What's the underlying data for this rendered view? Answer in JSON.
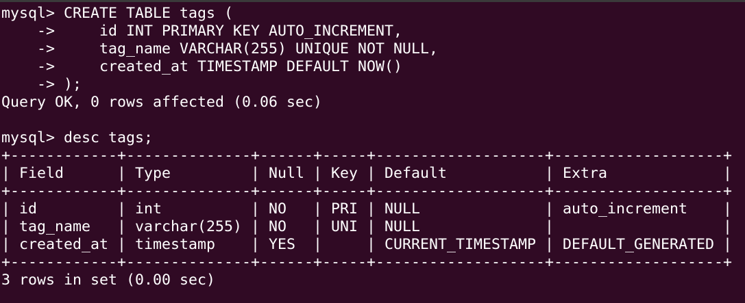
{
  "terminal": {
    "lines": [
      "mysql> CREATE TABLE tags (",
      "    ->     id INT PRIMARY KEY AUTO_INCREMENT,",
      "    ->     tag_name VARCHAR(255) UNIQUE NOT NULL,",
      "    ->     created_at TIMESTAMP DEFAULT NOW()",
      "    -> );",
      "Query OK, 0 rows affected (0.06 sec)",
      "",
      "mysql> desc tags;",
      "+------------+--------------+------+-----+-------------------+-------------------+",
      "| Field      | Type         | Null | Key | Default           | Extra             |",
      "+------------+--------------+------+-----+-------------------+-------------------+",
      "| id         | int          | NO   | PRI | NULL              | auto_increment    |",
      "| tag_name   | varchar(255) | NO   | UNI | NULL              |                   |",
      "| created_at | timestamp    | YES  |     | CURRENT_TIMESTAMP | DEFAULT_GENERATED |",
      "+------------+--------------+------+-----+-------------------+-------------------+",
      "3 rows in set (0.00 sec)"
    ]
  }
}
